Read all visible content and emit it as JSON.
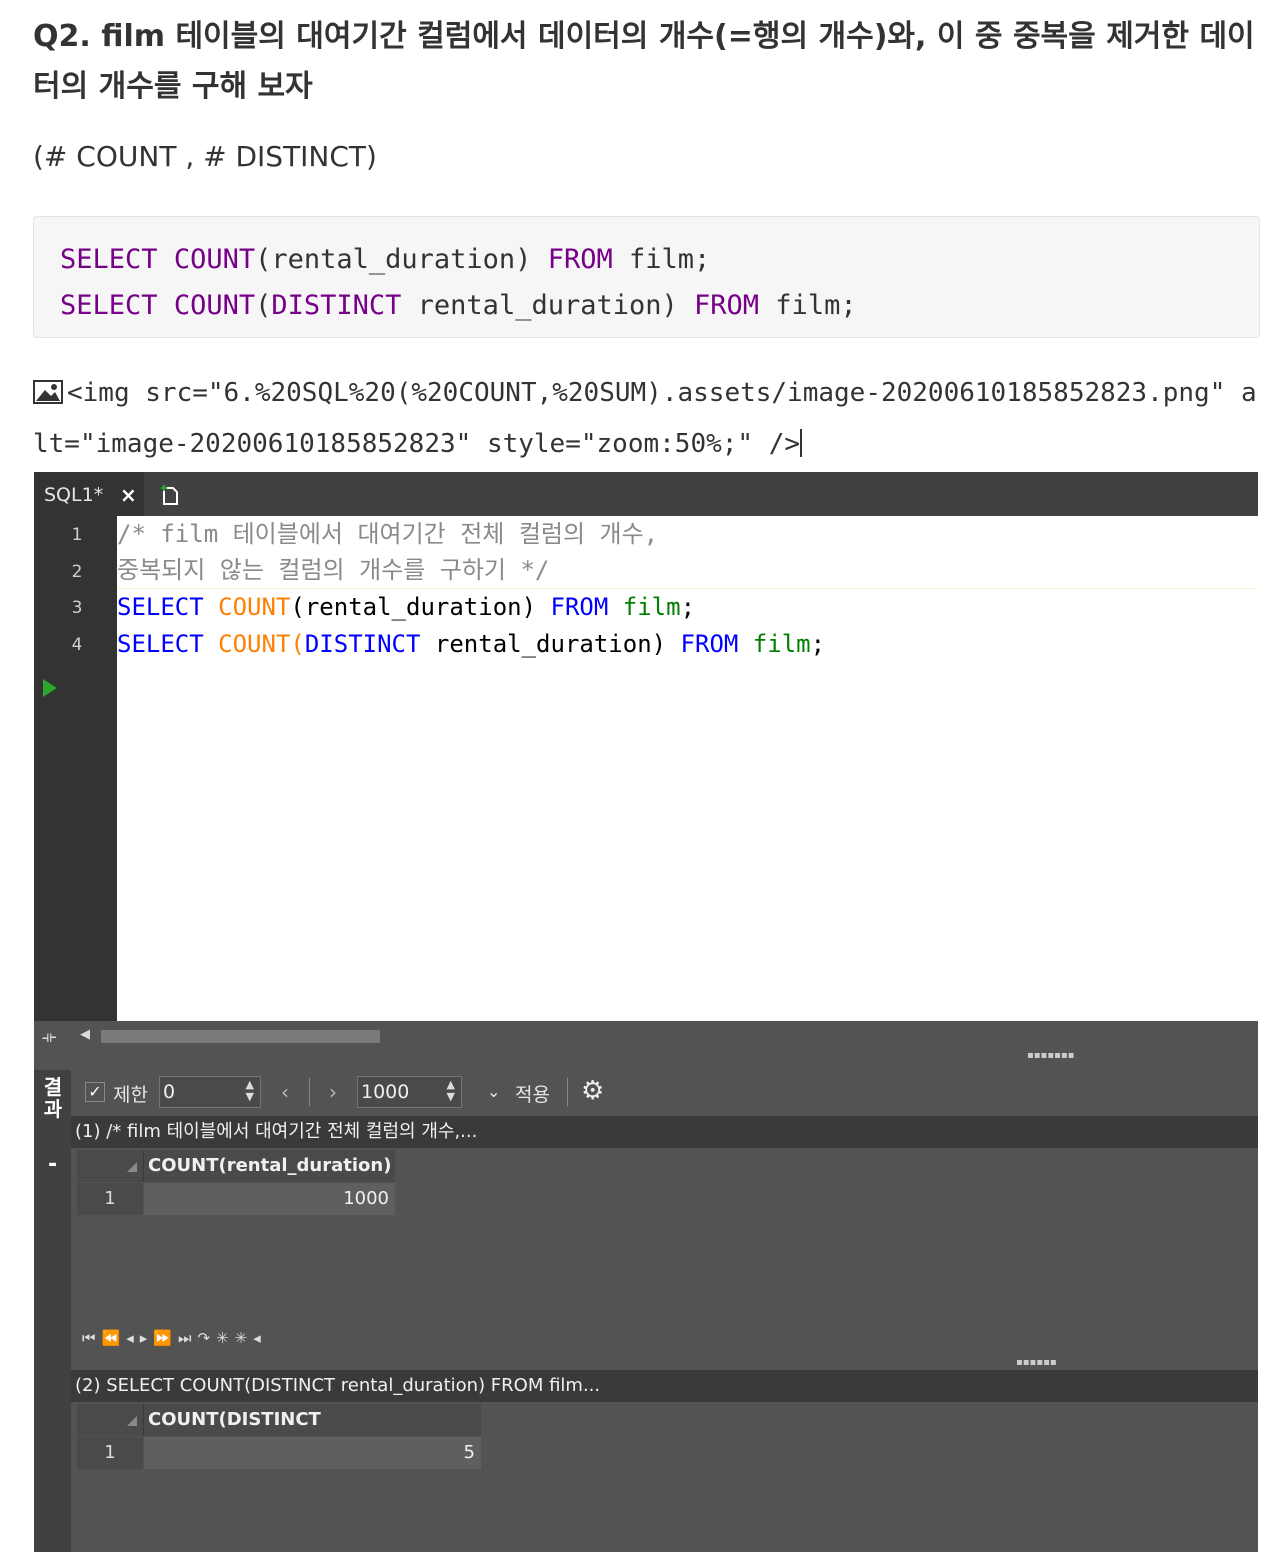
{
  "question": {
    "title": "Q2. film 테이블의 대여기간 컬럼에서 데이터의 개수(=행의 개수)와, 이 중 중복을 제거한 데이터의 개수를 구해 보자",
    "tags": "(# COUNT , # DISTINCT)"
  },
  "codeblock": {
    "line1": {
      "kw1": "SELECT",
      "kw2": "COUNT",
      "rest": "(rental_duration) ",
      "kw3": "FROM",
      "tail": " film;"
    },
    "line2": {
      "kw1": "SELECT",
      "kw2": "COUNT",
      "paren": "(",
      "kw_distinct": "DISTINCT",
      "rest": " rental_duration) ",
      "kw3": "FROM",
      "tail": " film;"
    }
  },
  "image_markup": "<img src=\"6.%20SQL%20(%20COUNT,%20SUM).assets/image-20200610185852823.png\" alt=\"image-20200610185852823\" style=\"zoom:50%;\" />",
  "ide": {
    "tab_label": "SQL1*",
    "tab_close": "×",
    "line_numbers": [
      "1",
      "2",
      "3",
      "4"
    ],
    "lines": {
      "l1": "/* film 테이블에서 대여기간 전체 컬럼의 개수,",
      "l2": "중복되지 않는 컬럼의 개수를 구하기 */",
      "l3": {
        "select": "SELECT",
        "count": "COUNT",
        "open": "(",
        "arg": "rental_duration",
        "close": ") ",
        "from": "FROM",
        "table": " film",
        "semi": ";"
      },
      "l4": {
        "select": "SELECT",
        "count": "COUNT",
        "open": "(",
        "distinct": "DISTINCT",
        "arg": " rental_duration",
        "close": ") ",
        "from": "FROM",
        "table": " film",
        "semi": ";"
      }
    },
    "results_tab_label": "결과",
    "toolbar": {
      "limit_label": "제한",
      "limit_value": "0",
      "page_size": "1000",
      "apply_label": "적용"
    },
    "result1": {
      "header": "(1) /* film 테이블에서 대여기간 전체 컬럼의 개수,...",
      "column": "COUNT(rental_duration)",
      "row_number": "1",
      "value": "1000"
    },
    "result2": {
      "header": "(2) SELECT COUNT(DISTINCT rental_duration) FROM film...",
      "column": "COUNT(DISTINCT rental_duration)",
      "row_number": "1",
      "value": "5"
    }
  },
  "colors": {
    "keyword_md": "#770088",
    "keyword_ide": "#0000ff",
    "function_ide": "#ff8000",
    "table_ide": "#008000",
    "comment_ide": "#8a8a8a",
    "ide_bg": "#535353"
  },
  "icons": [
    "broken-image-icon",
    "close-icon",
    "new-tab-icon",
    "run-arrow-icon",
    "settings-gear-icon",
    "checkbox-icon",
    "first-page-icon",
    "prev-page-icon",
    "next-page-icon",
    "last-page-icon"
  ]
}
